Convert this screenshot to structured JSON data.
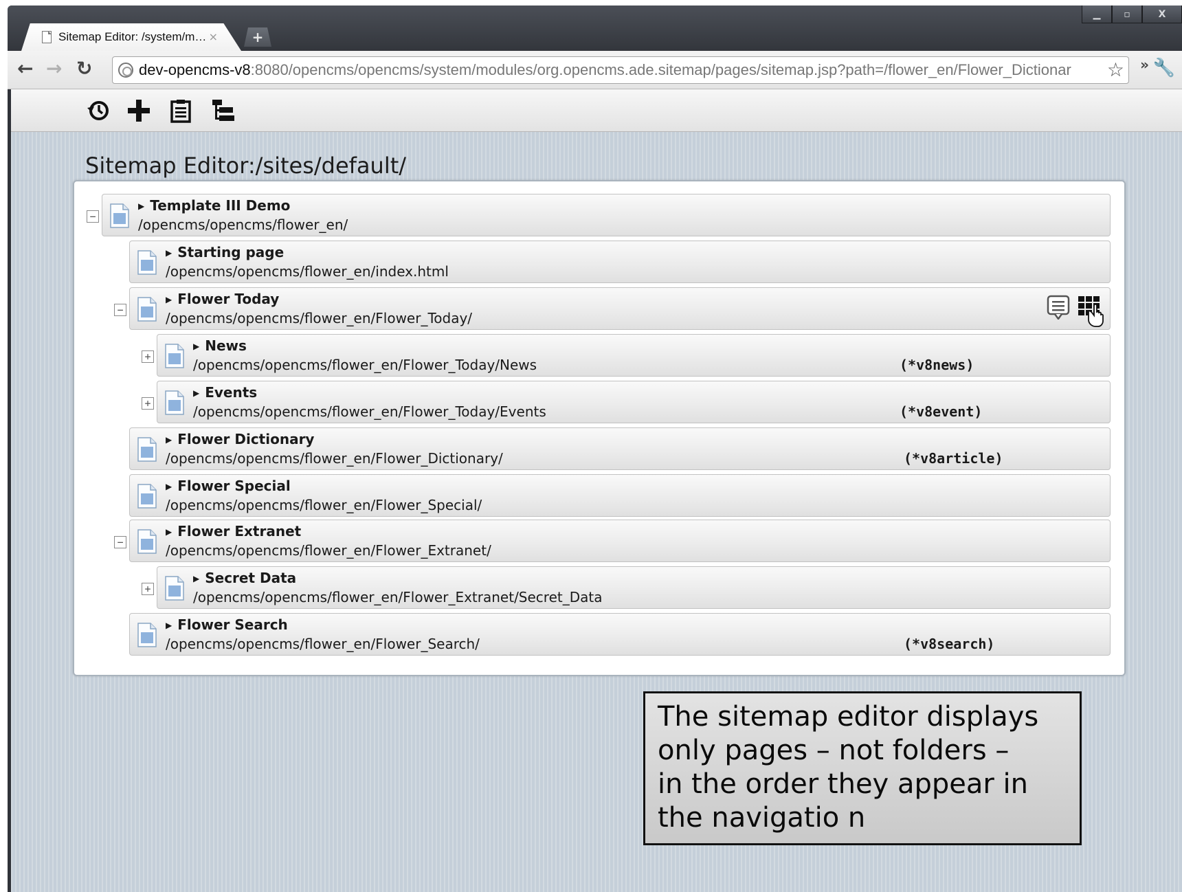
{
  "browser": {
    "tab_title": "Sitemap Editor: /system/m…",
    "tab_close": "×",
    "new_tab": "+",
    "url_host": "dev-opencms-v8",
    "url_rest": ":8080/opencms/opencms/system/modules/org.opencms.ade.sitemap/pages/sitemap.jsp?path=/flower_en/Flower_Dictionar",
    "window_buttons": {
      "minimize": "▁",
      "maximize": "▫",
      "close": "X"
    },
    "overflow_chevrons": "»"
  },
  "sitemap": {
    "title": "Sitemap Editor:/sites/default/",
    "entries": [
      {
        "title": "Template III Demo",
        "path": "/opencms/opencms/flower_en/",
        "type": "",
        "toggle": "−"
      },
      {
        "title": "Starting page",
        "path": "/opencms/opencms/flower_en/index.html",
        "type": "",
        "toggle": ""
      },
      {
        "title": "Flower Today",
        "path": "/opencms/opencms/flower_en/Flower_Today/",
        "type": "",
        "toggle": "−"
      },
      {
        "title": "News",
        "path": "/opencms/opencms/flower_en/Flower_Today/News",
        "type": "(*v8news)",
        "toggle": "+"
      },
      {
        "title": "Events",
        "path": "/opencms/opencms/flower_en/Flower_Today/Events",
        "type": "(*v8event)",
        "toggle": "+"
      },
      {
        "title": "Flower Dictionary",
        "path": "/opencms/opencms/flower_en/Flower_Dictionary/",
        "type": "(*v8article)",
        "toggle": ""
      },
      {
        "title": "Flower Special",
        "path": "/opencms/opencms/flower_en/Flower_Special/",
        "type": "",
        "toggle": ""
      },
      {
        "title": "Flower Extranet",
        "path": "/opencms/opencms/flower_en/Flower_Extranet/",
        "type": "",
        "toggle": "−"
      },
      {
        "title": "Secret Data",
        "path": "/opencms/opencms/flower_en/Flower_Extranet/Secret_Data",
        "type": "",
        "toggle": "+"
      },
      {
        "title": "Flower Search",
        "path": "/opencms/opencms/flower_en/Flower_Search/",
        "type": "(*v8search)",
        "toggle": ""
      }
    ]
  },
  "callout": {
    "line1": "The sitemap editor displays",
    "line2": "only pages – not folders –",
    "line3": "in the order they appear in",
    "line4": "the navigatio n"
  },
  "colors": {
    "content_background": "#c5cfd9",
    "entry_border": "#c2c2c2",
    "chrome_dark": "#2f3238"
  }
}
